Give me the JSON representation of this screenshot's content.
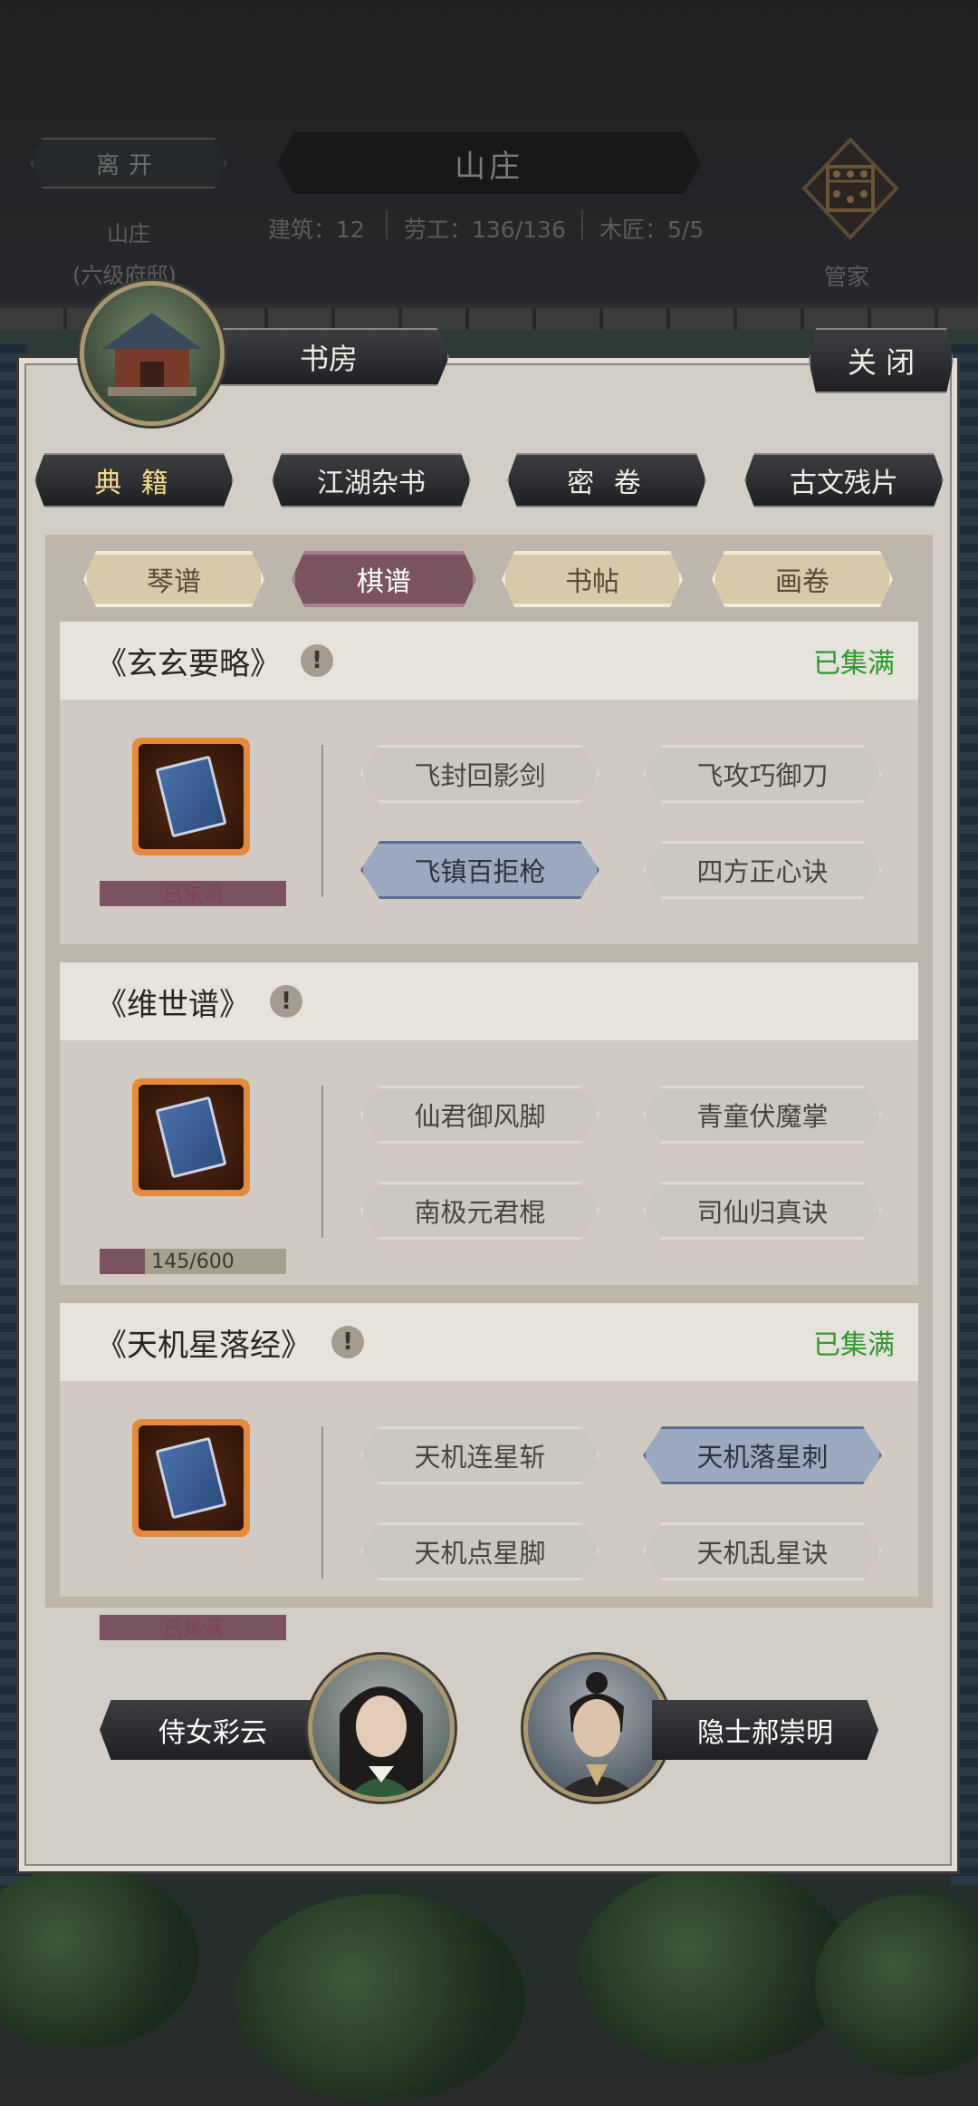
{
  "header": {
    "leave_label": "离开",
    "title": "山庄",
    "stats": {
      "building": "建筑：12",
      "labor": "劳工：136/136",
      "carpenter": "木匠：5/5"
    },
    "location_name": "山庄",
    "location_level": "(六级府邸)",
    "manager_label": "管家"
  },
  "panel": {
    "building_name": "书房",
    "close_label": "关 闭",
    "main_tabs": [
      {
        "label": "典 籍",
        "active": true
      },
      {
        "label": "江湖杂书",
        "active": false
      },
      {
        "label": "密 卷",
        "active": false
      },
      {
        "label": "古文残片",
        "active": false
      }
    ],
    "sub_tabs": [
      {
        "label": "琴谱",
        "active": false
      },
      {
        "label": "棋谱",
        "active": true
      },
      {
        "label": "书帖",
        "active": false
      },
      {
        "label": "画卷",
        "active": false
      }
    ],
    "books": [
      {
        "title": "《玄玄要略》",
        "status": "已集满",
        "progress_text": "已集满",
        "progress": 1.0,
        "skills": [
          "飞封回影剑",
          "飞攻巧御刀",
          "飞镇百拒枪",
          "四方正心诀"
        ],
        "highlighted": [
          false,
          false,
          true,
          false
        ]
      },
      {
        "title": "《维世谱》",
        "status": "",
        "progress_text": "145/600",
        "progress": 0.2417,
        "skills": [
          "仙君御风脚",
          "青童伏魔掌",
          "南极元君棍",
          "司仙归真诀"
        ],
        "highlighted": [
          false,
          false,
          false,
          false
        ]
      },
      {
        "title": "《天机星落经》",
        "status": "已集满",
        "progress_text": "已集满",
        "progress": 1.0,
        "skills": [
          "天机连星斩",
          "天机落星刺",
          "天机点星脚",
          "天机乱星诀"
        ],
        "highlighted": [
          false,
          true,
          false,
          false
        ]
      }
    ],
    "npcs": [
      {
        "name": "侍女彩云"
      },
      {
        "name": "隐士郝崇明"
      }
    ]
  },
  "colors": {
    "panel_bg": "#d2cdc5",
    "collected_green": "#2f9a2c",
    "active_subtab": "#7b5361",
    "highlight_skill": "#9ba8bd",
    "gold_text": "#f3dc8a"
  }
}
